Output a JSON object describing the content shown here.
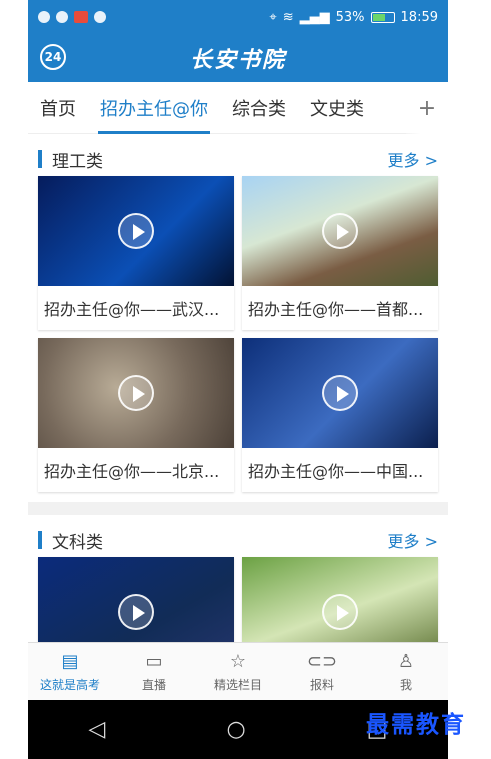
{
  "status": {
    "battery": "53%",
    "time": "18:59"
  },
  "header": {
    "round_label": "24",
    "logo": "长安书院"
  },
  "tabs": [
    {
      "label": "首页"
    },
    {
      "label": "招办主任@你"
    },
    {
      "label": "综合类"
    },
    {
      "label": "文史类"
    }
  ],
  "tab_plus": "+",
  "sections": [
    {
      "title": "理工类",
      "more": "更多 >",
      "items": [
        {
          "caption": "招办主任@你——武汉..."
        },
        {
          "caption": "招办主任@你——首都..."
        },
        {
          "caption": "招办主任@你——北京..."
        },
        {
          "caption": "招办主任@你——中国..."
        }
      ]
    },
    {
      "title": "文科类",
      "more": "更多 >",
      "items": [
        {
          "caption": ""
        },
        {
          "caption": ""
        }
      ]
    }
  ],
  "bottom_nav": [
    {
      "label": "这就是高考",
      "icon": "book-icon"
    },
    {
      "label": "直播",
      "icon": "tv-icon"
    },
    {
      "label": "精选栏目",
      "icon": "star-icon"
    },
    {
      "label": "报料",
      "icon": "tag-icon"
    },
    {
      "label": "我",
      "icon": "user-icon"
    }
  ],
  "system_nav": {
    "back": "◁",
    "home": "○",
    "recent": "□"
  },
  "watermark": "最需教育"
}
